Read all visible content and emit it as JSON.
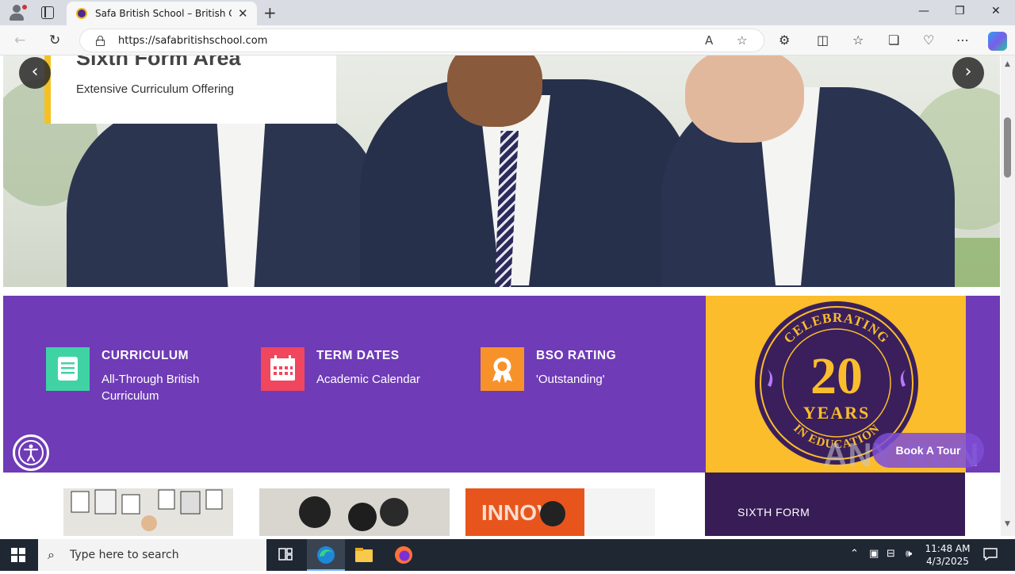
{
  "browser": {
    "tab_title": "Safa British School – British Curri",
    "url": "https://safabritishschool.com",
    "new_tab": "+",
    "close_tab": "✕",
    "window": {
      "minimize": "—",
      "restore": "❐",
      "close": "✕"
    }
  },
  "hero": {
    "title": "Sixth Form Area",
    "subtitle": "Extensive Curriculum Offering",
    "prev_arrow": "‹",
    "next_arrow": "›"
  },
  "features": [
    {
      "title": "CURRICULUM",
      "desc": "All-Through British Curriculum",
      "color": "#3fd3a4",
      "icon": "book-icon"
    },
    {
      "title": "TERM DATES",
      "desc": "Academic Calendar",
      "color": "#f0465e",
      "icon": "calendar-icon"
    },
    {
      "title": "BSO RATING",
      "desc": "'Outstanding'",
      "color": "#f7922b",
      "icon": "award-icon"
    }
  ],
  "badge": {
    "top_text": "CELEBRATING",
    "number": "20",
    "years": "YEARS",
    "bottom_text": "IN EDUCATION",
    "bg_color": "#fbbd2c",
    "seal_color": "#3a1f5c"
  },
  "lower": {
    "dark_label": "SIXTH FORM",
    "book_tour": "Book A Tour",
    "watermark": "ANY RUN"
  },
  "colors": {
    "band": "#6f3bb7",
    "accent": "#f5c122"
  },
  "taskbar": {
    "search_placeholder": "Type here to search",
    "time": "11:48 AM",
    "date": "4/3/2025"
  }
}
